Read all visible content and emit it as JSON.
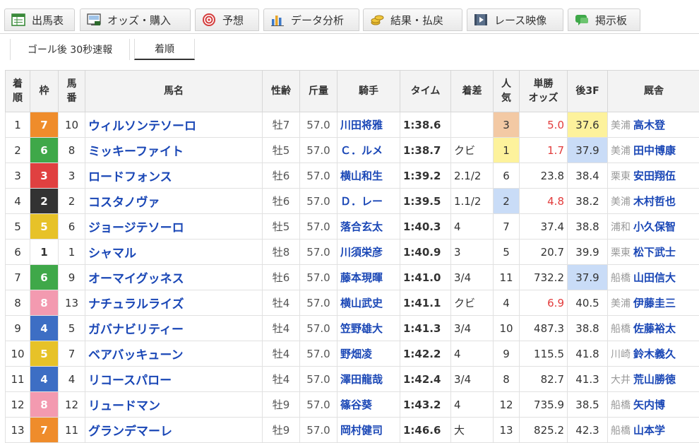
{
  "tabs": [
    {
      "label": "出馬表",
      "icon": "shutuba-table-icon"
    },
    {
      "label": "オッズ・購入",
      "icon": "odds-ipat-icon"
    },
    {
      "label": "予想",
      "icon": "target-icon"
    },
    {
      "label": "データ分析",
      "icon": "bar-chart-icon"
    },
    {
      "label": "結果・払戻",
      "icon": "coins-icon"
    },
    {
      "label": "レース映像",
      "icon": "video-play-icon"
    },
    {
      "label": "掲示板",
      "icon": "chat-bubble-icon"
    }
  ],
  "subtabs": [
    {
      "label": "ゴール後 30秒速報"
    },
    {
      "label": "着順"
    }
  ],
  "colors": {
    "waku1": "#ffffff",
    "waku2": "#333333",
    "waku3": "#e04040",
    "waku4": "#3d6ec4",
    "waku5": "#e7c228",
    "waku6": "#3fa849",
    "waku7": "#ef8c2b",
    "waku8": "#f39ab0",
    "link": "#1a47b6",
    "odds_red": "#e23b3b"
  },
  "headers": {
    "rank": "着順",
    "waku": "枠",
    "umaban": "馬番",
    "name": "馬名",
    "sexage": "性齢",
    "weight": "斤量",
    "jockey": "騎手",
    "time": "タイム",
    "margin": "着差",
    "pop": "人気",
    "odds": "単勝オッズ",
    "f3": "後3F",
    "trainer": "厩舎"
  },
  "rows": [
    {
      "rank": "1",
      "waku": "7",
      "umaban": "10",
      "name": "ウィルソンテソーロ",
      "sexage": "牡7",
      "weight": "57.0",
      "jockey": "川田将雅",
      "time": "1:38.6",
      "margin": "",
      "pop": "3",
      "odds": "5.0",
      "f3": "37.6",
      "belong": "美浦",
      "trainer": "高木登"
    },
    {
      "rank": "2",
      "waku": "6",
      "umaban": "8",
      "name": "ミッキーファイト",
      "sexage": "牡5",
      "weight": "57.0",
      "jockey": "Ｃ．ルメ",
      "time": "1:38.7",
      "margin": "クビ",
      "pop": "1",
      "odds": "1.7",
      "f3": "37.9",
      "belong": "美浦",
      "trainer": "田中博康"
    },
    {
      "rank": "3",
      "waku": "3",
      "umaban": "3",
      "name": "ロードフォンス",
      "sexage": "牡6",
      "weight": "57.0",
      "jockey": "横山和生",
      "time": "1:39.2",
      "margin": "2.1/2",
      "pop": "6",
      "odds": "23.8",
      "f3": "38.4",
      "belong": "栗東",
      "trainer": "安田翔伍"
    },
    {
      "rank": "4",
      "waku": "2",
      "umaban": "2",
      "name": "コスタノヴァ",
      "sexage": "牡6",
      "weight": "57.0",
      "jockey": "Ｄ．レー",
      "time": "1:39.5",
      "margin": "1.1/2",
      "pop": "2",
      "odds": "4.8",
      "f3": "38.2",
      "belong": "美浦",
      "trainer": "木村哲也"
    },
    {
      "rank": "5",
      "waku": "5",
      "umaban": "6",
      "name": "ジョージテソーロ",
      "sexage": "牡5",
      "weight": "57.0",
      "jockey": "落合玄太",
      "time": "1:40.3",
      "margin": "4",
      "pop": "7",
      "odds": "37.4",
      "f3": "38.8",
      "belong": "浦和",
      "trainer": "小久保智"
    },
    {
      "rank": "6",
      "waku": "1",
      "umaban": "1",
      "name": "シャマル",
      "sexage": "牡8",
      "weight": "57.0",
      "jockey": "川須栄彦",
      "time": "1:40.9",
      "margin": "3",
      "pop": "5",
      "odds": "20.7",
      "f3": "39.9",
      "belong": "栗東",
      "trainer": "松下武士"
    },
    {
      "rank": "7",
      "waku": "6",
      "umaban": "9",
      "name": "オーマイグッネス",
      "sexage": "牡6",
      "weight": "57.0",
      "jockey": "藤本現暉",
      "time": "1:41.0",
      "margin": "3/4",
      "pop": "11",
      "odds": "732.2",
      "f3": "37.9",
      "belong": "船橋",
      "trainer": "山田信大"
    },
    {
      "rank": "8",
      "waku": "8",
      "umaban": "13",
      "name": "ナチュラルライズ",
      "sexage": "牡4",
      "weight": "57.0",
      "jockey": "横山武史",
      "time": "1:41.1",
      "margin": "クビ",
      "pop": "4",
      "odds": "6.9",
      "f3": "40.5",
      "belong": "美浦",
      "trainer": "伊藤圭三"
    },
    {
      "rank": "9",
      "waku": "4",
      "umaban": "5",
      "name": "ガバナビリティー",
      "sexage": "牡4",
      "weight": "57.0",
      "jockey": "笠野雄大",
      "time": "1:41.3",
      "margin": "3/4",
      "pop": "10",
      "odds": "487.3",
      "f3": "38.8",
      "belong": "船橋",
      "trainer": "佐藤裕太"
    },
    {
      "rank": "10",
      "waku": "5",
      "umaban": "7",
      "name": "ベアバッキューン",
      "sexage": "牡4",
      "weight": "57.0",
      "jockey": "野畑凌",
      "time": "1:42.2",
      "margin": "4",
      "pop": "9",
      "odds": "115.5",
      "f3": "41.8",
      "belong": "川崎",
      "trainer": "鈴木義久"
    },
    {
      "rank": "11",
      "waku": "4",
      "umaban": "4",
      "name": "リコースパロー",
      "sexage": "牡4",
      "weight": "57.0",
      "jockey": "澤田龍哉",
      "time": "1:42.4",
      "margin": "3/4",
      "pop": "8",
      "odds": "82.7",
      "f3": "41.3",
      "belong": "大井",
      "trainer": "荒山勝徳"
    },
    {
      "rank": "12",
      "waku": "8",
      "umaban": "12",
      "name": "リュードマン",
      "sexage": "牡9",
      "weight": "57.0",
      "jockey": "篠谷葵",
      "time": "1:43.2",
      "margin": "4",
      "pop": "12",
      "odds": "735.9",
      "f3": "38.5",
      "belong": "船橋",
      "trainer": "矢内博"
    },
    {
      "rank": "13",
      "waku": "7",
      "umaban": "11",
      "name": "グランデマーレ",
      "sexage": "牡9",
      "weight": "57.0",
      "jockey": "岡村健司",
      "time": "1:46.6",
      "margin": "大",
      "pop": "13",
      "odds": "825.2",
      "f3": "42.3",
      "belong": "船橋",
      "trainer": "山本学"
    }
  ]
}
